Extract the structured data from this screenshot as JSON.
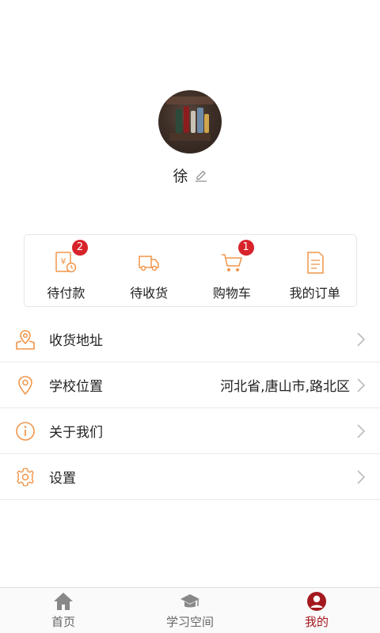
{
  "profile": {
    "name": "徐"
  },
  "orders": [
    {
      "label": "待付款",
      "badge": "2",
      "icon": "payment-pending-icon"
    },
    {
      "label": "待收货",
      "badge": "",
      "icon": "truck-icon"
    },
    {
      "label": "购物车",
      "badge": "1",
      "icon": "cart-icon"
    },
    {
      "label": "我的订单",
      "badge": "",
      "icon": "order-list-icon"
    }
  ],
  "menu": [
    {
      "label": "收货地址",
      "value": "",
      "icon": "map-pin-icon"
    },
    {
      "label": "学校位置",
      "value": "河北省,唐山市,路北区",
      "icon": "location-icon"
    },
    {
      "label": "关于我们",
      "value": "",
      "icon": "info-icon"
    },
    {
      "label": "设置",
      "value": "",
      "icon": "gear-icon"
    }
  ],
  "tabbar": [
    {
      "label": "首页",
      "icon": "home-icon",
      "active": false
    },
    {
      "label": "学习空间",
      "icon": "graduation-cap-icon",
      "active": false
    },
    {
      "label": "我的",
      "icon": "user-icon",
      "active": true
    }
  ],
  "colors": {
    "accent": "#f0954a",
    "badge": "#d8232a",
    "active_tab": "#a3191f"
  }
}
